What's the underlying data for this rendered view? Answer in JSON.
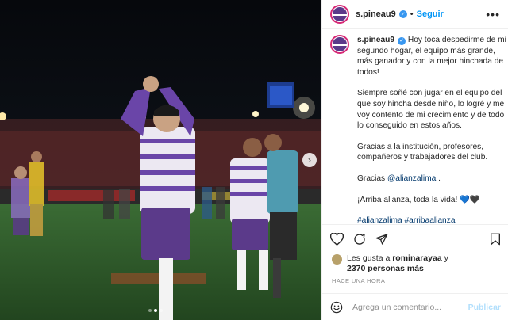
{
  "post": {
    "username": "s.pineau9",
    "follow_label": "Seguir",
    "separator": "•",
    "verified_glyph": "✓",
    "more_glyph": "•••"
  },
  "caption": {
    "username": "s.pineau9",
    "p1": " Hoy toca despedirme de mi segundo hogar, el equipo más grande, más ganador y con la mejor hinchada de todos!",
    "p2": "Siempre soñé con jugar en el equipo del que soy hincha desde niño, lo logré y me voy contento de mi crecimiento y de todo lo conseguido en estos años.",
    "p3": "Gracias a la institución, profesores, compañeros y trabajadores del club.",
    "p4_prefix": "Gracias ",
    "p4_mention": "@alianzalima",
    "p4_suffix": " .",
    "p5": "¡Arriba alianza, toda la vida! 💙🖤",
    "hashtag1": "#alianzalima",
    "hashtag2": "#arribaalianza"
  },
  "likes": {
    "prefix": "Les gusta a ",
    "user": "rominarayaa",
    "mid": " y",
    "count": "2370 personas más"
  },
  "time": "HACE UNA HORA",
  "comment": {
    "placeholder": "Agrega un comentario...",
    "publish_label": "Publicar"
  },
  "carousel": {
    "next_glyph": "›",
    "total": 3,
    "current": 2
  },
  "icons": [
    "heart-icon",
    "comment-icon",
    "share-icon",
    "bookmark-icon",
    "emoji-icon",
    "verified-icon",
    "chevron-right-icon",
    "more-icon"
  ],
  "colors": {
    "follow": "#0095f6",
    "verified": "#3897f0",
    "hashtag": "#00376b",
    "publish_disabled": "#b2dffc",
    "jersey_purple": "#5b3a8a"
  }
}
